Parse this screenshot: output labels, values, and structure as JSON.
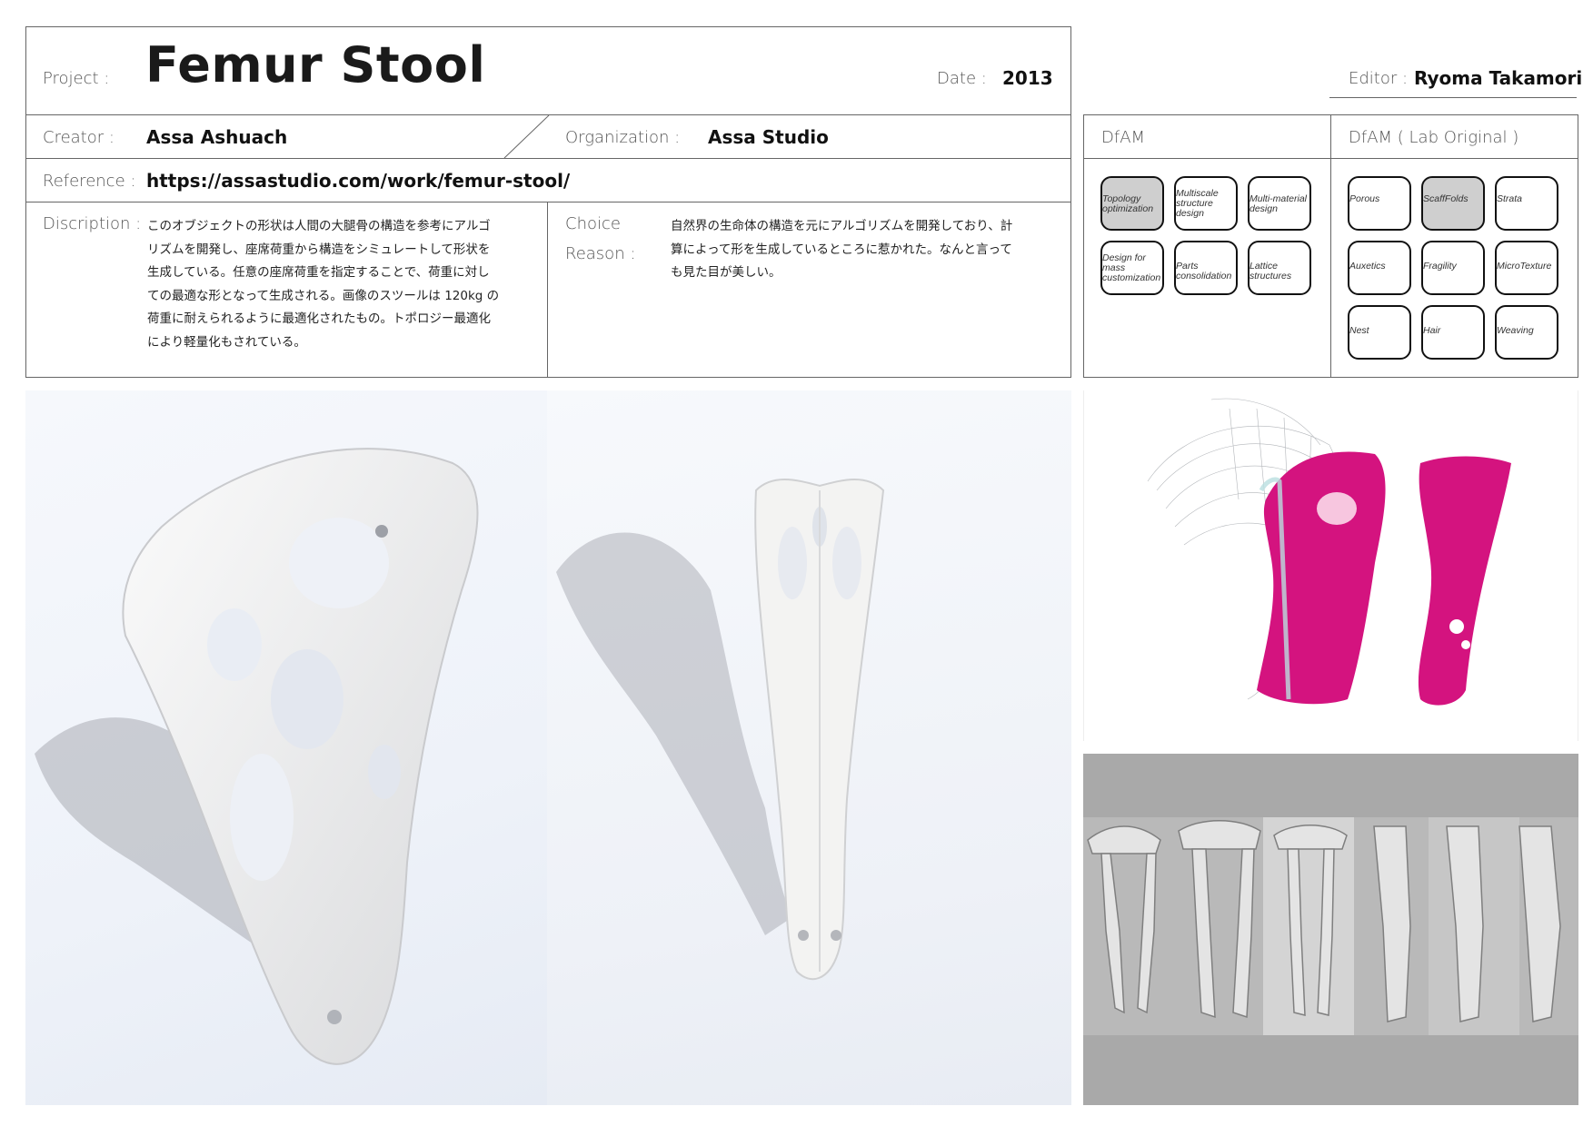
{
  "header": {
    "project_label": "Project :",
    "project_title": "Femur Stool",
    "date_label": "Date :",
    "date_value": "2013",
    "editor_label": "Editor :",
    "editor_value": "Ryoma Takamori"
  },
  "meta": {
    "creator_label": "Creator :",
    "creator_value": "Assa Ashuach",
    "organization_label": "Organization :",
    "organization_value": "Assa Studio",
    "reference_label": "Reference :",
    "reference_value": "https://assastudio.com/work/femur-stool/"
  },
  "description": {
    "label": "Discription :",
    "lines": [
      "このオブジェクトの形状は人間の大腿骨の構造を参考にアルゴ",
      "リズムを開発し、座席荷重から構造をシミュレートして形状を",
      "生成している。任意の座席荷重を指定することで、荷重に対し",
      "ての最適な形となって生成される。画像のスツールは 120kg の",
      "荷重に耐えられるように最適化されたもの。トポロジー最適化",
      "により軽量化もされている。"
    ]
  },
  "choice": {
    "label_line1": "Choice",
    "label_line2": "Reason :",
    "lines": [
      "自然界の生命体の構造を元にアルゴリズムを開発しており、計",
      "算によって形を生成しているところに惹かれた。なんと言って",
      "も見た目が美しい。"
    ]
  },
  "dfam": {
    "header": "DfAM",
    "tags": [
      {
        "label": "Topology optimization",
        "selected": true
      },
      {
        "label": "Multiscale structure design",
        "selected": false
      },
      {
        "label": "Multi-material design",
        "selected": false
      },
      {
        "label": "Design for mass customization",
        "selected": false
      },
      {
        "label": "Parts consolidation",
        "selected": false
      },
      {
        "label": "Lattice structures",
        "selected": false
      }
    ]
  },
  "dfam_lab": {
    "header": "DfAM ( Lab Original )",
    "tags": [
      {
        "label": "Porous",
        "selected": false
      },
      {
        "label": "ScaffFolds",
        "selected": true
      },
      {
        "label": "Strata",
        "selected": false
      },
      {
        "label": "Auxetics",
        "selected": false
      },
      {
        "label": "Fragility",
        "selected": false
      },
      {
        "label": "MicroTexture",
        "selected": false
      },
      {
        "label": "Nest",
        "selected": false
      },
      {
        "label": "Hair",
        "selected": false
      },
      {
        "label": "Weaving",
        "selected": false
      }
    ]
  },
  "colors": {
    "selected_tag": "#cfcfcf",
    "magenta": "#d4137f",
    "bone_gray": "#c9c9c9"
  }
}
